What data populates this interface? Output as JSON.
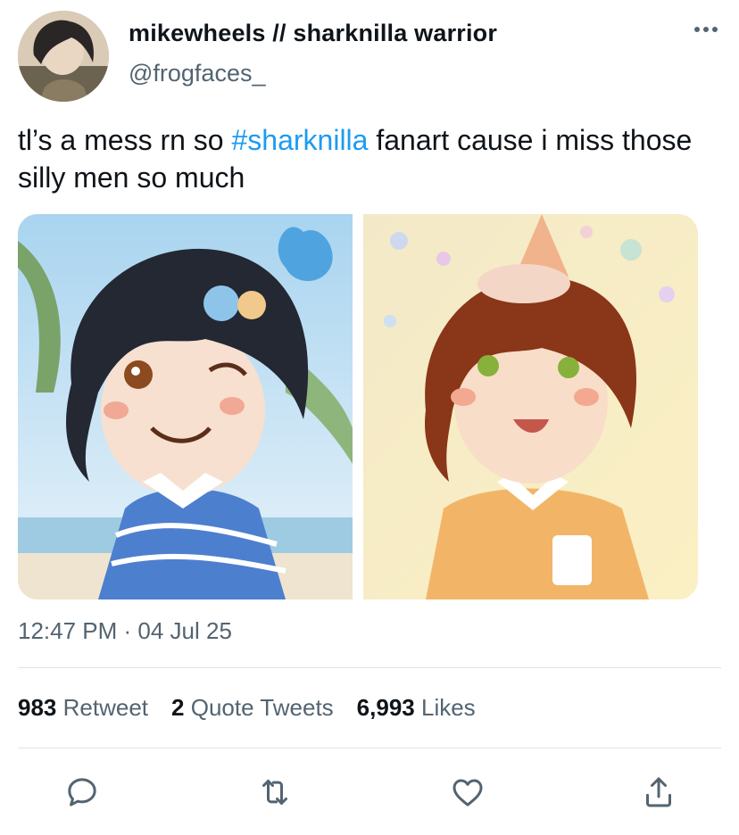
{
  "author": {
    "display_name": "mikewheels // sharknilla warrior",
    "handle": "@frogfaces_",
    "avatar_icon": "profile-avatar"
  },
  "tweet": {
    "text_before": "tl’s a mess rn so ",
    "hashtag": "#sharknilla",
    "text_after": " fanart cause i miss those silly men so much",
    "timestamp": "12:47 PM · 04 Jul 25"
  },
  "media": [
    {
      "alt_icon": "fanart-image-shark"
    },
    {
      "alt_icon": "fanart-image-vanilla"
    }
  ],
  "stats": {
    "retweets_count": "983",
    "retweets_label": "Retweet",
    "quotes_count": "2",
    "quotes_label": "Quote Tweets",
    "likes_count": "6,993",
    "likes_label": "Likes"
  },
  "actions": [
    "reply-icon",
    "retweet-icon",
    "like-icon",
    "share-icon"
  ],
  "colors": {
    "text": "#0f1419",
    "secondary": "#536471",
    "accent": "#1d9bf0",
    "divider": "#dfe3e6"
  }
}
